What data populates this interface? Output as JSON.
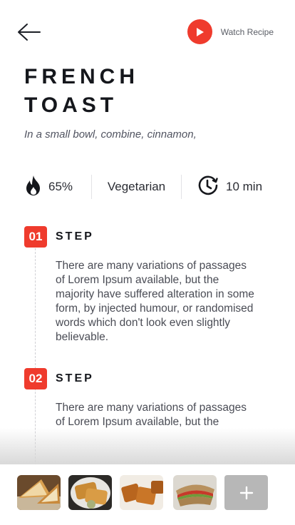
{
  "header": {
    "watch_label": "Watch Recipe"
  },
  "recipe": {
    "title_line1": "FRENCH",
    "title_line2": "TOAST",
    "subtitle": "In a small bowl, combine, cinnamon,"
  },
  "stats": {
    "calories": "65%",
    "diet": "Vegetarian",
    "time": "10 min"
  },
  "steps": [
    {
      "number": "01",
      "label": "STEP",
      "text": "There are many variations of passages of Lorem Ipsum available, but the majority have suffered alteration in some form, by injected humour, or randomised words which don't look even slightly believable."
    },
    {
      "number": "02",
      "label": "STEP",
      "text": "There are many variations of passages of Lorem Ipsum available, but the"
    }
  ],
  "colors": {
    "accent": "#ef3b2d",
    "add_button": "#b7b7b7"
  },
  "icons": {
    "back": "arrow-left-icon",
    "play": "play-icon",
    "flame": "flame-icon",
    "clock": "clock-icon",
    "plus": "plus-icon"
  }
}
